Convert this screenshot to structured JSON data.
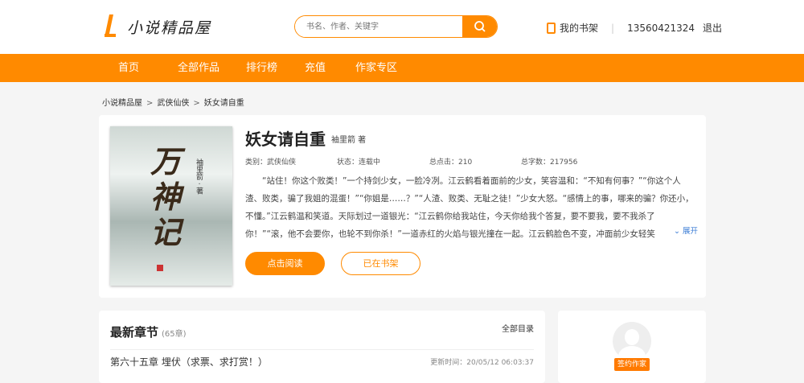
{
  "header": {
    "logo_text": "小说精品屋",
    "search_placeholder": "书名、作者、关键字",
    "bookshelf": "我的书架",
    "phone": "13560421324",
    "logout": "退出",
    "sep": "|"
  },
  "nav": [
    "首页",
    "全部作品",
    "排行榜",
    "充值",
    "作家专区"
  ],
  "breadcrumb": [
    "小说精品屋",
    "武侠仙侠",
    "妖女请自重"
  ],
  "breadcrumb_sep": ">",
  "book": {
    "cover_title": "万神记",
    "cover_author": "袖里箭 · 著",
    "title": "妖女请自重",
    "author": "袖里箭 著",
    "category": "类别：武侠仙侠",
    "status": "状态：连载中",
    "clicks": "总点击：210",
    "words": "总字数：217956",
    "intro": "“站住！你这个败类！”一个持剑少女，一脸冷冽。江云鹤看着面前的少女，笑容温和：“不知有何事？”“你这个人渣、败类，骗了我姐的混蛋！”“你姐是……？”“人渣、败类、无耻之徒！”少女大怒。“感情上的事，哪来的骗？你还小，不懂。”江云鹤温和笑道。天际划过一道银光：“江云鹤你给我站住，今天你给我个答复，要不要我，要不我杀了你！”“滚，他不会要你，也轮不到你杀！”一道赤红的火焰与银光撞在一起。江云鹤脸色不变，冲面前少女轻笑",
    "expand": "展开",
    "read_btn": "点击阅读",
    "shelf_btn": "已在书架"
  },
  "chapters": {
    "title": "最新章节",
    "count": "(65章)",
    "all": "全部目录",
    "latest": "第六十五章 埋伏（求票、求打赏！）",
    "update_time": "更新时间：20/05/12 06:03:37"
  },
  "author_card": {
    "badge": "签约作家"
  }
}
